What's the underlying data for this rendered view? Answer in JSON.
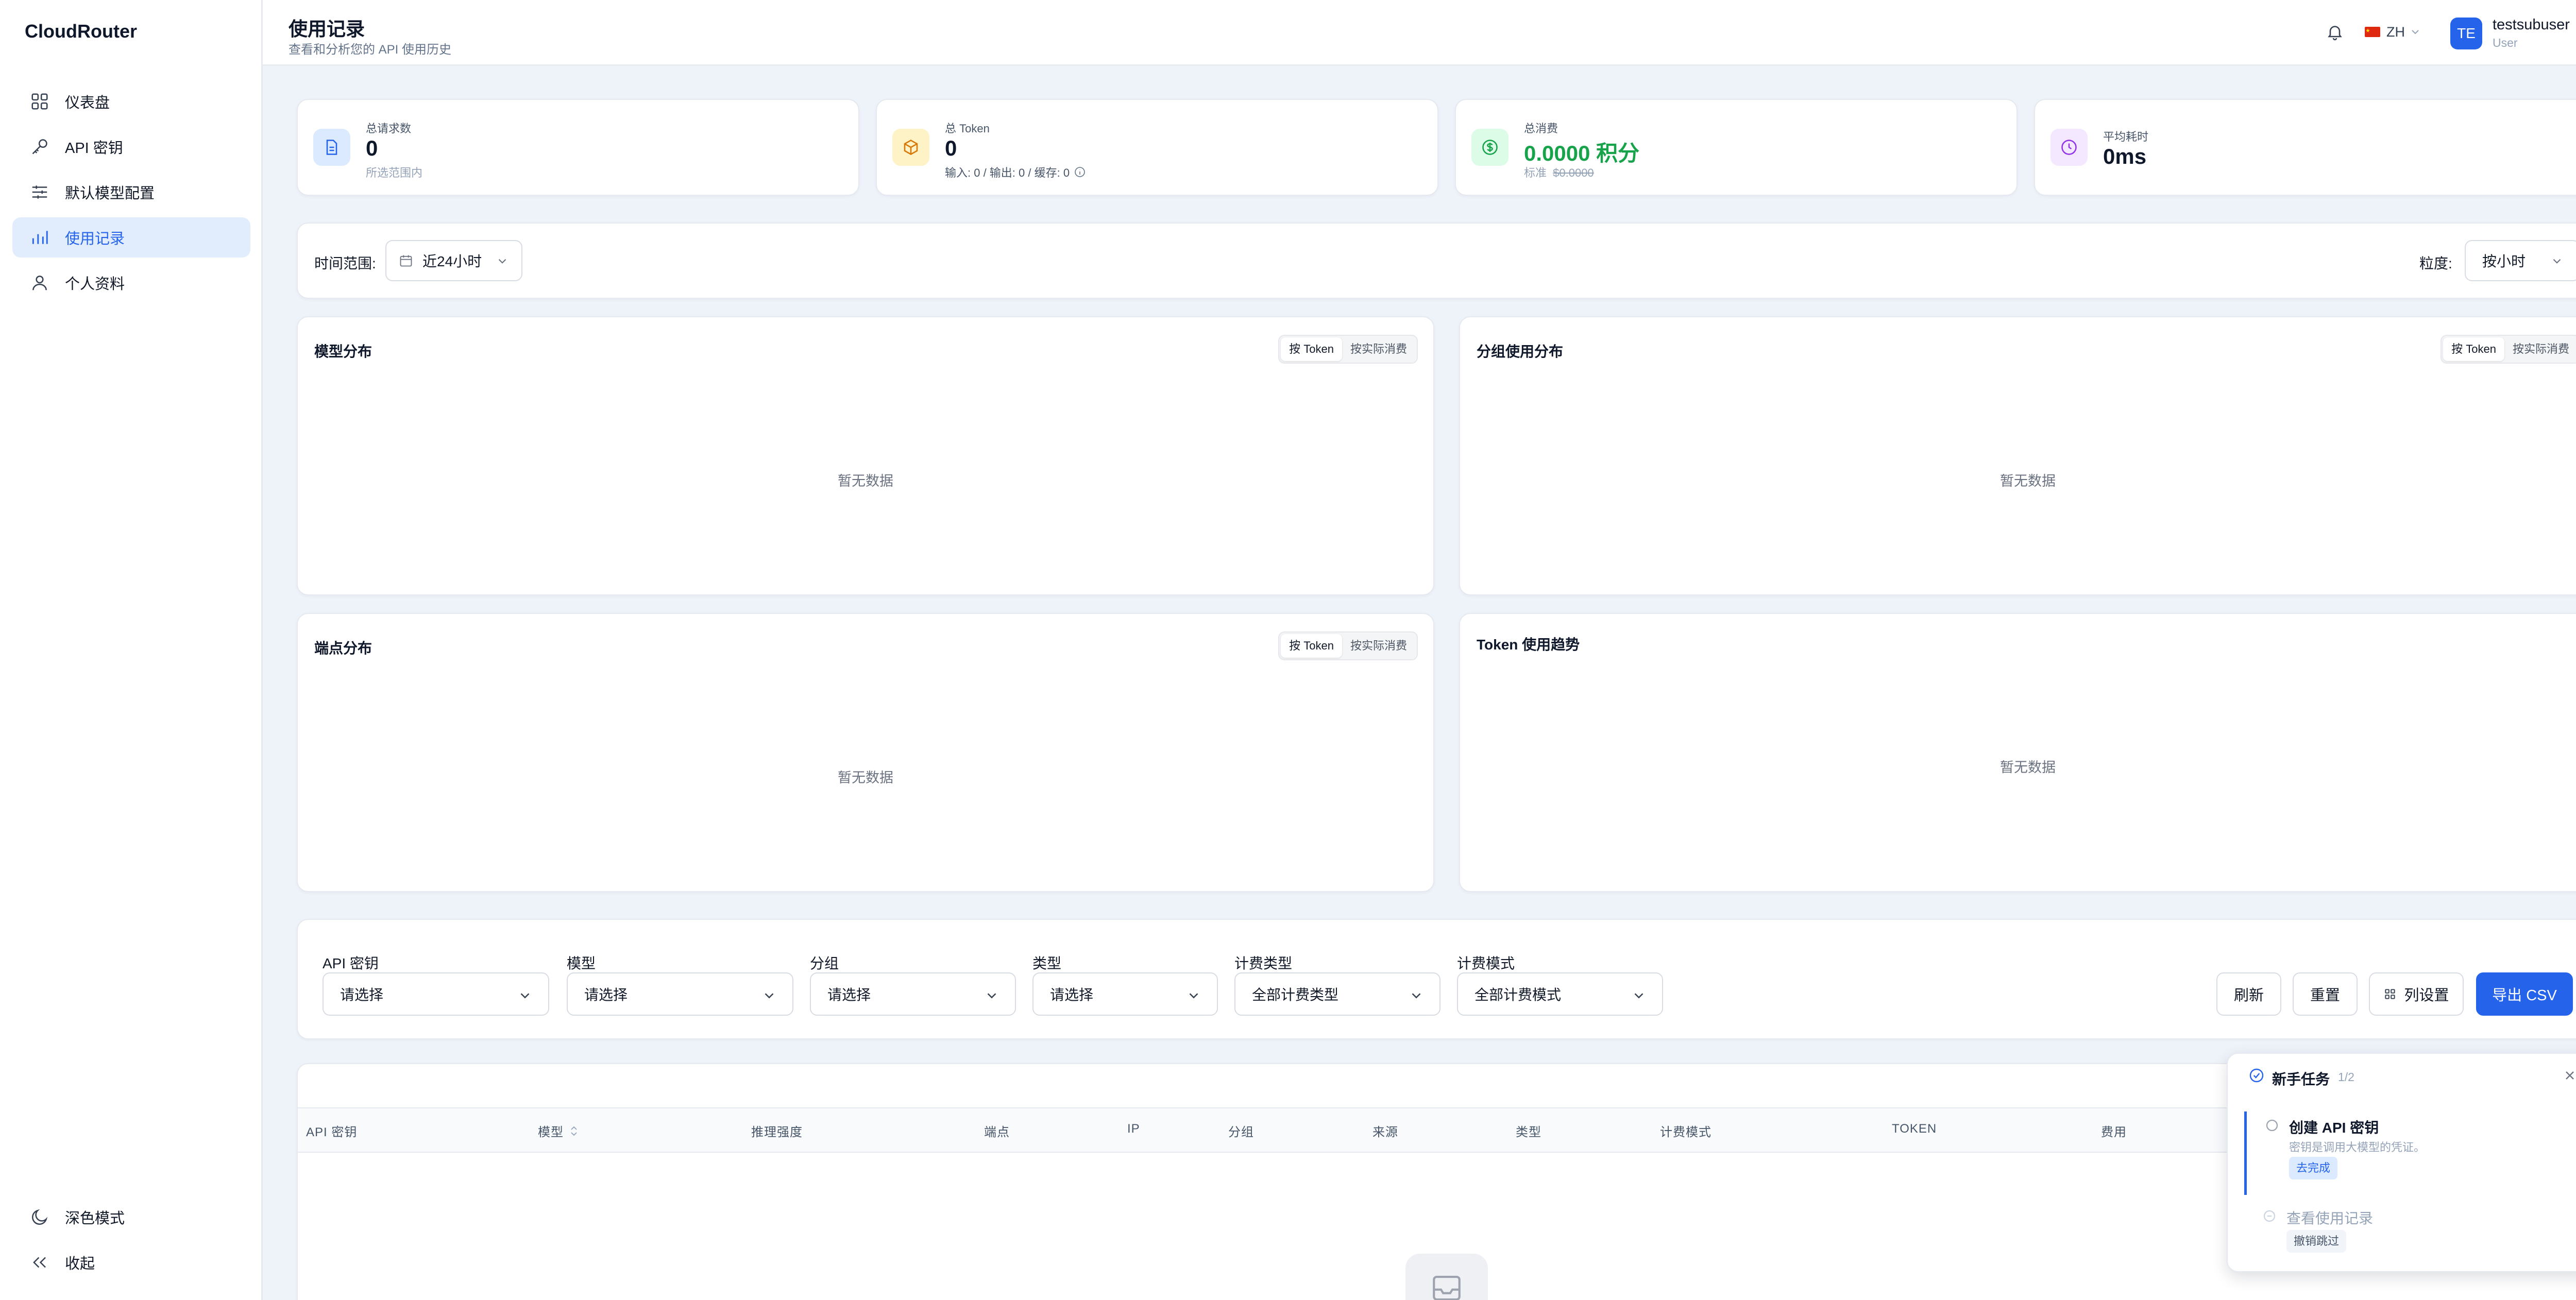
{
  "sidebar": {
    "brand": "CloudRouter",
    "items": [
      {
        "label": "仪表盘"
      },
      {
        "label": "API 密钥"
      },
      {
        "label": "默认模型配置"
      },
      {
        "label": "使用记录"
      },
      {
        "label": "个人资料"
      }
    ],
    "dark_mode": "深色模式",
    "collapse": "收起"
  },
  "header": {
    "title": "使用记录",
    "subtitle": "查看和分析您的 API 使用历史",
    "lang": "ZH",
    "avatar_initials": "TE",
    "username": "testsubuser",
    "role": "User"
  },
  "stats": [
    {
      "label": "总请求数",
      "value": "0",
      "sub": "所选范围内"
    },
    {
      "label": "总 Token",
      "value": "0",
      "sub": "输入: 0 / 输出: 0 / 缓存: 0"
    },
    {
      "label": "总消费",
      "value": "0.0000 积分",
      "sub_prefix": "标准",
      "sub_strike": "$0.0000"
    },
    {
      "label": "平均耗时",
      "value": "0ms"
    }
  ],
  "range": {
    "label": "时间范围:",
    "value": "近24小时",
    "gran_label": "粒度:",
    "gran_value": "按小时"
  },
  "charts": {
    "model": {
      "title": "模型分布",
      "seg_a": "按 Token",
      "seg_b": "按实际消费",
      "empty": "暂无数据"
    },
    "group": {
      "title": "分组使用分布",
      "seg_a": "按 Token",
      "seg_b": "按实际消费",
      "empty": "暂无数据"
    },
    "endpoint": {
      "title": "端点分布",
      "seg_a": "按 Token",
      "seg_b": "按实际消费",
      "empty": "暂无数据"
    },
    "trend": {
      "title": "Token 使用趋势",
      "empty": "暂无数据"
    }
  },
  "filters": {
    "api_key": {
      "label": "API 密钥",
      "value": "请选择"
    },
    "model": {
      "label": "模型",
      "value": "请选择"
    },
    "group": {
      "label": "分组",
      "value": "请选择"
    },
    "type": {
      "label": "类型",
      "value": "请选择"
    },
    "billing_type": {
      "label": "计费类型",
      "value": "全部计费类型"
    },
    "billing_mode": {
      "label": "计费模式",
      "value": "全部计费模式"
    },
    "refresh": "刷新",
    "reset": "重置",
    "columns": "列设置",
    "export": "导出 CSV"
  },
  "table": {
    "columns": [
      "API 密钥",
      "模型",
      "推理强度",
      "端点",
      "IP",
      "分组",
      "来源",
      "类型",
      "计费模式",
      "TOKEN",
      "费用"
    ]
  },
  "onboarding": {
    "title": "新手任务",
    "progress": "1/2",
    "tasks": [
      {
        "title": "创建 API 密钥",
        "desc": "密钥是调用大模型的凭证。",
        "action": "去完成"
      },
      {
        "title": "查看使用记录",
        "action": "撤销跳过"
      }
    ]
  },
  "colors": {
    "accent": "#2563eb",
    "success": "#16a34a"
  }
}
